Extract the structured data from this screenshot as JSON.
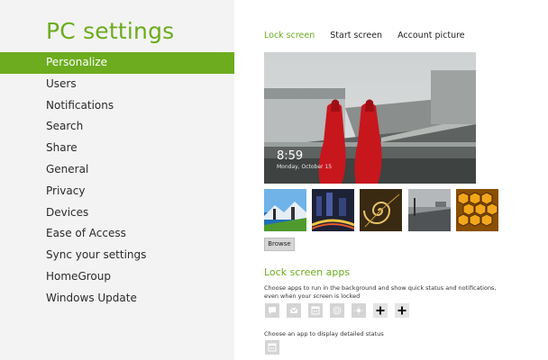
{
  "app_title": "PC settings",
  "nav": {
    "items": [
      {
        "label": "Personalize"
      },
      {
        "label": "Users"
      },
      {
        "label": "Notifications"
      },
      {
        "label": "Search"
      },
      {
        "label": "Share"
      },
      {
        "label": "General"
      },
      {
        "label": "Privacy"
      },
      {
        "label": "Devices"
      },
      {
        "label": "Ease of Access"
      },
      {
        "label": "Sync your settings"
      },
      {
        "label": "HomeGroup"
      },
      {
        "label": "Windows Update"
      }
    ],
    "selected": "Personalize"
  },
  "tabs": [
    {
      "label": "Lock screen",
      "active": true
    },
    {
      "label": "Start screen",
      "active": false
    },
    {
      "label": "Account picture",
      "active": false
    }
  ],
  "preview": {
    "time": "8:59",
    "date": "Monday, October 15"
  },
  "thumbnails": [
    "seattle-skyline-thumbnail",
    "city-night-traffic-thumbnail",
    "nautilus-shell-thumbnail",
    "grey-pier-thumbnail",
    "honeycomb-thumbnail"
  ],
  "browse_label": "Browse",
  "lock_screen_apps": {
    "title": "Lock screen apps",
    "description": "Choose apps to run in the background and show quick status and notifications, even when your screen is locked",
    "apps": [
      {
        "icon": "messaging-icon"
      },
      {
        "icon": "mail-icon"
      },
      {
        "icon": "calendar-icon"
      },
      {
        "icon": "feed-icon"
      },
      {
        "icon": "weather-icon"
      },
      {
        "icon": "add-icon"
      },
      {
        "icon": "add-icon"
      }
    ],
    "detail_label": "Choose an app to display detailed status",
    "detail_icon": "calendar-icon"
  },
  "colors": {
    "accent": "#6cac1e",
    "sidebar_bg": "#f3f3f3"
  }
}
